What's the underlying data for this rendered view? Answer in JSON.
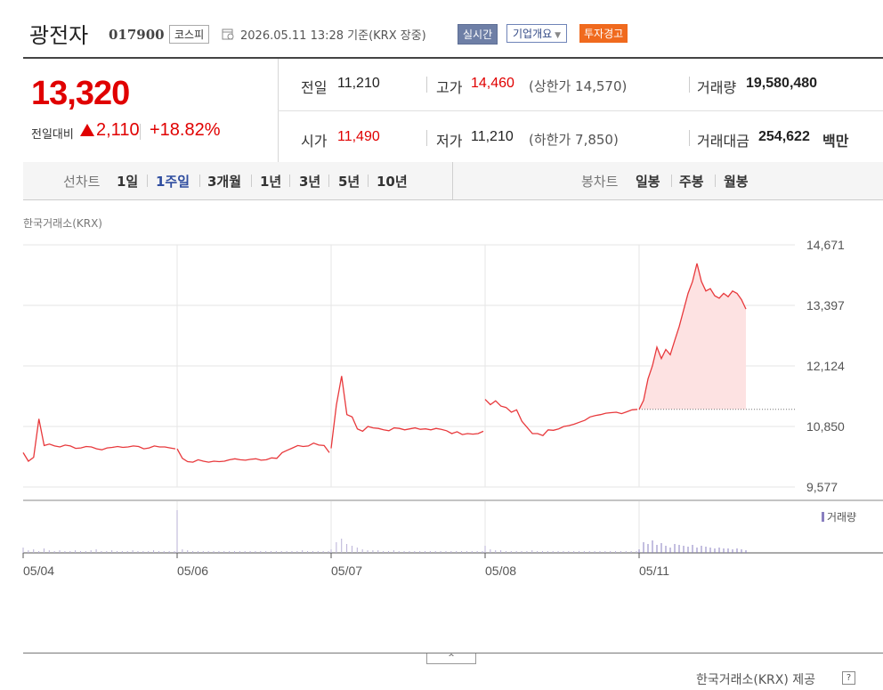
{
  "header": {
    "title": "광전자",
    "code": "017900",
    "market": "코스피",
    "datetime": "2026.05.11 13:28  기준(KRX 장중)",
    "realtime": "실시간",
    "corp_info": "기업개요",
    "warning": "투자경고"
  },
  "quote": {
    "price": "13,320",
    "change_label": "전일대비",
    "change_value": "2,110",
    "change_pct": "+18.82%",
    "prev_label": "전일",
    "prev": "11,210",
    "open_label": "시가",
    "open": "11,490",
    "high_label": "고가",
    "high": "14,460",
    "upper_limit": "(상한가 14,570)",
    "low_label": "저가",
    "low": "11,210",
    "lower_limit": "(하한가 7,850)",
    "volume_label": "거래량",
    "volume": "19,580,480",
    "amount_label": "거래대금",
    "amount": "254,622",
    "amount_unit": "백만",
    "color_up": "#e00000"
  },
  "nav": {
    "line_label": "선차트",
    "line_periods": [
      "1일",
      "1주일",
      "3개월",
      "1년",
      "3년",
      "5년",
      "10년"
    ],
    "selected": "1주일",
    "candle_label": "봉차트",
    "candle_periods": [
      "일봉",
      "주봉",
      "월봉"
    ]
  },
  "chart_data": {
    "type": "line",
    "exchange_label": "한국거래소(KRX)",
    "y_ticks": [
      "14,671",
      "13,397",
      "12,124",
      "10,850",
      "9,577"
    ],
    "ylim": [
      9577,
      14671
    ],
    "x_ticks": [
      "05/04",
      "05/06",
      "05/07",
      "05/08",
      "05/11"
    ],
    "volume_legend": "거래량",
    "prev_close": 11210,
    "line_color": "#e8393c",
    "fill_color": "#fde2e2",
    "series": [
      {
        "values": [
          10300,
          10120,
          10200,
          11010,
          10450,
          10480,
          10440,
          10420,
          10460,
          10440,
          10390,
          10400,
          10430,
          10420,
          10380,
          10360,
          10400,
          10410,
          10430,
          10410,
          10420,
          10440,
          10430,
          10380,
          10400,
          10440,
          10420,
          10420,
          10400,
          10380
        ]
      },
      {
        "values": [
          10380,
          10180,
          10110,
          10100,
          10150,
          10120,
          10100,
          10120,
          10110,
          10120,
          10150,
          10170,
          10150,
          10140,
          10160,
          10170,
          10140,
          10150,
          10190,
          10180,
          10300,
          10350,
          10400,
          10450,
          10430,
          10440,
          10500,
          10460,
          10450,
          10300
        ]
      },
      {
        "values": [
          10390,
          11300,
          11910,
          11100,
          11050,
          10800,
          10750,
          10850,
          10820,
          10810,
          10780,
          10760,
          10820,
          10810,
          10780,
          10800,
          10820,
          10790,
          10800,
          10780,
          10810,
          10790,
          10760,
          10700,
          10740,
          10680,
          10700,
          10690,
          10700,
          10750
        ]
      },
      {
        "values": [
          11420,
          11310,
          11390,
          11280,
          11250,
          11150,
          11200,
          10960,
          10830,
          10700,
          10700,
          10660,
          10780,
          10770,
          10800,
          10850,
          10870,
          10900,
          10940,
          10980,
          11050,
          11080,
          11100,
          11130,
          11140,
          11150,
          11120,
          11160,
          11200,
          11210
        ]
      },
      {
        "values": [
          11210,
          11400,
          11850,
          12130,
          12520,
          12280,
          12470,
          12360,
          12660,
          12950,
          13300,
          13650,
          13900,
          14280,
          13900,
          13700,
          13750,
          13600,
          13550,
          13650,
          13580,
          13700,
          13650,
          13520,
          13320
        ]
      }
    ],
    "volume": [
      [
        6,
        3,
        4,
        2,
        5,
        3,
        2,
        3,
        2,
        2,
        3,
        2,
        2,
        3,
        4,
        2,
        2,
        3,
        2,
        2,
        2,
        3,
        2,
        2,
        2,
        3,
        2,
        2,
        2,
        2
      ],
      [
        48,
        4,
        3,
        2,
        2,
        2,
        2,
        2,
        2,
        2,
        2,
        2,
        2,
        2,
        2,
        2,
        2,
        2,
        2,
        2,
        2,
        2,
        2,
        2,
        3,
        2,
        2,
        2,
        2,
        2
      ],
      [
        4,
        12,
        16,
        10,
        8,
        6,
        4,
        3,
        3,
        3,
        2,
        2,
        3,
        2,
        2,
        2,
        2,
        2,
        2,
        2,
        2,
        2,
        2,
        2,
        2,
        2,
        2,
        2,
        2,
        2
      ],
      [
        8,
        4,
        3,
        3,
        2,
        2,
        2,
        2,
        2,
        3,
        2,
        2,
        2,
        2,
        2,
        2,
        2,
        2,
        2,
        2,
        2,
        2,
        2,
        2,
        2,
        2,
        2,
        2,
        2,
        2
      ],
      [
        4,
        12,
        10,
        14,
        9,
        11,
        8,
        6,
        10,
        9,
        8,
        7,
        9,
        6,
        8,
        7,
        6,
        5,
        6,
        5,
        5,
        4,
        5,
        4,
        3
      ]
    ]
  },
  "footer": {
    "source": "한국거래소(KRX) 제공",
    "help": "?",
    "collapse": "^"
  }
}
